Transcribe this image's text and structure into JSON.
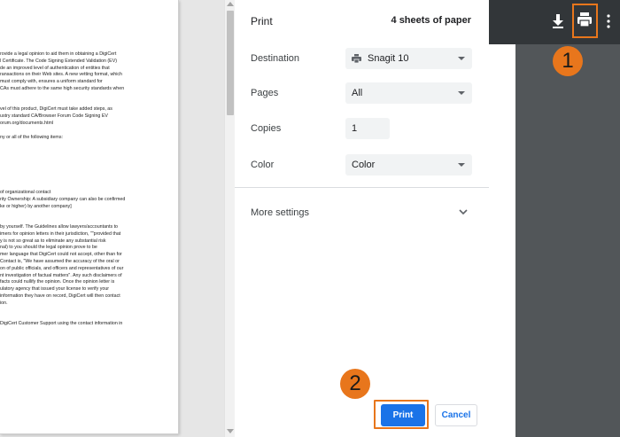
{
  "preview": {
    "lines": [
      "rovide a legal opinion to aid them in obtaining a DigiCert",
      "l Certificate. The Code Signing Extended Validation (EV)",
      "de an improved level of authentication of entities that",
      "ransactions on their Web sites. A new vetting format, which",
      " must comply with, ensures a uniform standard for",
      "CAs must adhere to the same high security standards when",
      "",
      "",
      "vel of this product, DigiCert must take added steps, as",
      "ustry standard CA/Browser Forum Code Signing EV",
      "orum.org/documents.html",
      "",
      "ny or all of the following items:",
      "",
      "",
      "",
      "",
      "",
      "",
      "",
      "of organizational contact",
      "rity Ownership: A subsidiary company can also be confirmed",
      "ke or higher) by another company]",
      "",
      "",
      " by yourself. The Guidelines allow lawyers/accountants to",
      "imers for opinion letters in their jurisdiction, \"\"provided that",
      "y is not so great as to eliminate any substantial risk",
      "nal) to you should the legal opinion prove to be",
      "mer language that DigiCert could not accept, other than for",
      "Contact is, \"We have assumed the accuracy of the oral or",
      "on of public officials, and officers and representatives of our",
      "nt investigation of factual matters\". Any such disclaimers of",
      "facts could nullify the opinion. Once the opinion letter is",
      "ulatory agency that issued your license to verify your",
      "information they have on record, DigiCert will then contact",
      "ion.",
      "",
      "",
      "DigiCert Customer Support using the contact information in"
    ]
  },
  "dialog": {
    "title": "Print",
    "sheets": "4 sheets of paper",
    "destination_label": "Destination",
    "destination_value": "Snagit 10",
    "pages_label": "Pages",
    "pages_value": "All",
    "copies_label": "Copies",
    "copies_value": "1",
    "color_label": "Color",
    "color_value": "Color",
    "more_settings_label": "More settings",
    "print_button": "Print",
    "cancel_button": "Cancel"
  },
  "steps": {
    "step1": "1",
    "step2": "2"
  },
  "colors": {
    "accent": "#1a73e8",
    "highlight": "#e8761c",
    "toolbar": "#323639",
    "viewer_bg": "#525659"
  }
}
